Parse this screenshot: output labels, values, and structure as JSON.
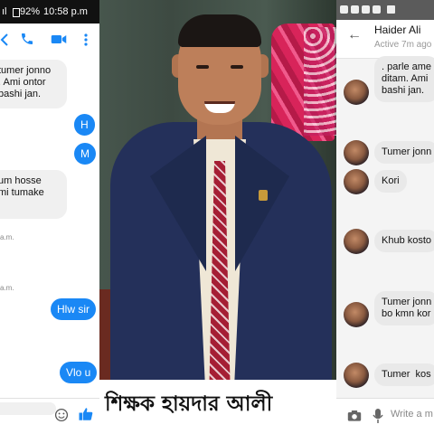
{
  "left_panel": {
    "status": {
      "network": "ıl",
      "battery": "92%",
      "time": "10:58 p.m"
    },
    "messages_in": [
      {
        "text": "tumer jonno\n. Ami ontor\nbashi jan."
      },
      {
        "text": "um hosse\nmi tumake"
      }
    ],
    "messages_out": [
      {
        "text": "H"
      },
      {
        "text": "M"
      },
      {
        "text": "Hlw sir"
      },
      {
        "text": "Vlo u"
      }
    ],
    "timestamps": [
      "a.m.",
      "a.m."
    ]
  },
  "middle_panel": {
    "caption": "শিক্ষক হায়দার আলী"
  },
  "right_panel": {
    "contact_name": "Haider Ali",
    "active_status": "Active 7m ago",
    "messages": [
      {
        "text": ". parle ame\nditam. Ami\nbashi jan."
      },
      {
        "text": "Tumer jonn"
      },
      {
        "text": "Kori"
      },
      {
        "text": "Khub kosto"
      },
      {
        "text": "Tumer jonn\nbo kmn kor"
      },
      {
        "text": "Tumer  kos"
      }
    ],
    "input_placeholder": "Write a m"
  },
  "colors": {
    "sent_bubble": "#1a88f5",
    "received_bubble": "#f0f0f0",
    "messenger_blue": "#1a88f5"
  }
}
